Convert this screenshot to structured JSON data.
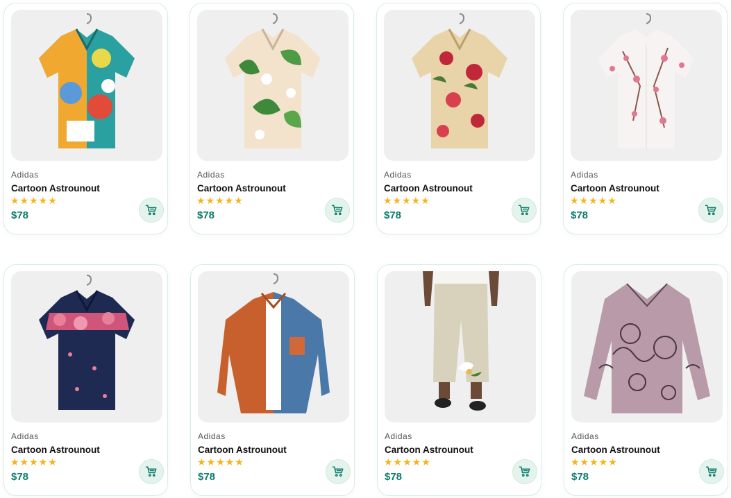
{
  "theme": {
    "price_color": "#0b7a6d",
    "star_color": "#f3b51b",
    "cart_bg": "#e4f4ec",
    "card_border": "#d8ece4"
  },
  "products": [
    {
      "brand": "Adidas",
      "name": "Cartoon Astrounout",
      "rating": 5,
      "stars": "★★★★★",
      "price": "$78",
      "image": "abstract-print-shirt",
      "cart_icon": "cart-icon"
    },
    {
      "brand": "Adidas",
      "name": "Cartoon Astrounout",
      "rating": 5,
      "stars": "★★★★★",
      "price": "$78",
      "image": "tropical-leaf-shirt",
      "cart_icon": "cart-icon"
    },
    {
      "brand": "Adidas",
      "name": "Cartoon Astrounout",
      "rating": 5,
      "stars": "★★★★★",
      "price": "$78",
      "image": "floral-rose-shirt",
      "cart_icon": "cart-icon"
    },
    {
      "brand": "Adidas",
      "name": "Cartoon Astrounout",
      "rating": 5,
      "stars": "★★★★★",
      "price": "$78",
      "image": "cherry-blossom-shirt",
      "cart_icon": "cart-icon"
    },
    {
      "brand": "Adidas",
      "name": "Cartoon Astrounout",
      "rating": 5,
      "stars": "★★★★★",
      "price": "$78",
      "image": "navy-floral-shirt",
      "cart_icon": "cart-icon"
    },
    {
      "brand": "Adidas",
      "name": "Cartoon Astrounout",
      "rating": 5,
      "stars": "★★★★★",
      "price": "$78",
      "image": "orange-blue-shirt",
      "cart_icon": "cart-icon"
    },
    {
      "brand": "Adidas",
      "name": "Cartoon Astrounout",
      "rating": 5,
      "stars": "★★★★★",
      "price": "$78",
      "image": "linen-pants",
      "cart_icon": "cart-icon"
    },
    {
      "brand": "Adidas",
      "name": "Cartoon Astrounout",
      "rating": 5,
      "stars": "★★★★★",
      "price": "$78",
      "image": "mauve-printed-top",
      "cart_icon": "cart-icon"
    }
  ]
}
